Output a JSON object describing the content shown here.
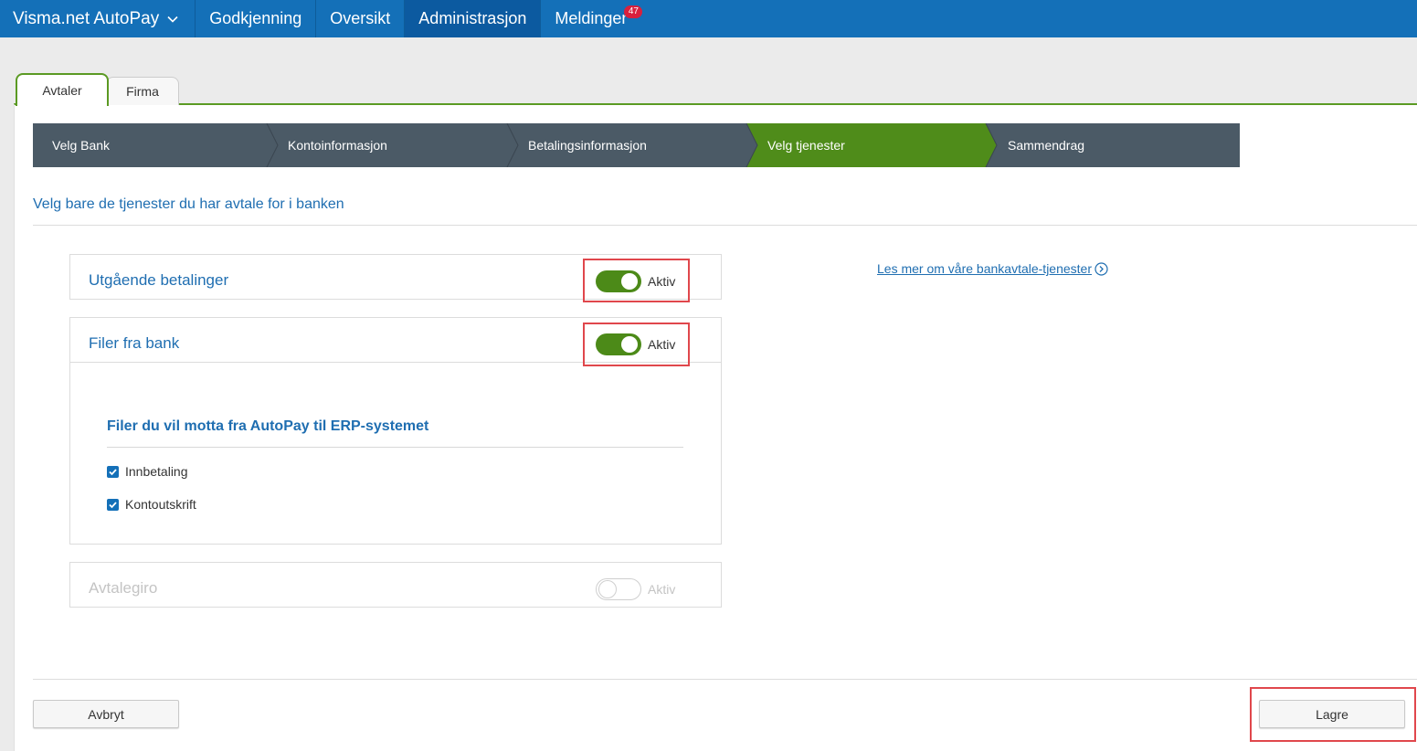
{
  "nav": {
    "brand": "Visma.net AutoPay",
    "items": [
      {
        "label": "Godkjenning"
      },
      {
        "label": "Oversikt"
      },
      {
        "label": "Administrasjon"
      },
      {
        "label": "Meldinger",
        "badge": "47"
      }
    ]
  },
  "tabs": [
    {
      "label": "Avtaler",
      "active": true
    },
    {
      "label": "Firma",
      "active": false
    }
  ],
  "wizard": {
    "steps": [
      {
        "label": "Velg Bank",
        "state": "done"
      },
      {
        "label": "Kontoinformasjon",
        "state": "done"
      },
      {
        "label": "Betalingsinformasjon",
        "state": "done"
      },
      {
        "label": "Velg tjenester",
        "state": "current"
      },
      {
        "label": "Sammendrag",
        "state": "pending"
      }
    ]
  },
  "intro": "Velg bare de tjenester du har avtale for i banken",
  "services": [
    {
      "title": "Utgående betalinger",
      "toggle_label": "Aktiv",
      "active": true
    },
    {
      "title": "Filer fra bank",
      "toggle_label": "Aktiv",
      "active": true
    },
    {
      "title": "Avtalegiro",
      "toggle_label": "Aktiv",
      "active": false
    }
  ],
  "files_section": {
    "title": "Filer du vil motta fra AutoPay til ERP-systemet",
    "options": [
      {
        "label": "Innbetaling",
        "checked": true
      },
      {
        "label": "Kontoutskrift",
        "checked": true
      }
    ]
  },
  "more_link": "Les mer om våre bankavtale-tjenester",
  "buttons": {
    "cancel": "Avbryt",
    "save": "Lagre"
  },
  "colors": {
    "nav_bg": "#1470b8",
    "accent_green": "#4c8a18",
    "step_done": "#4b5a66",
    "step_current": "#4f8c1a",
    "link_blue": "#1f6eb1",
    "highlight_red": "#e0474c"
  }
}
